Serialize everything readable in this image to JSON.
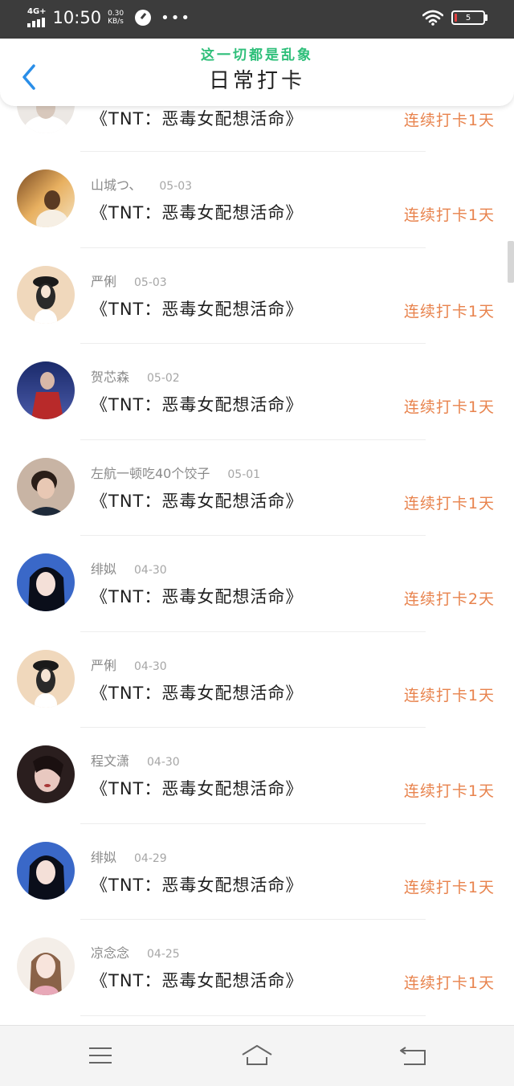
{
  "status_bar": {
    "network": "4G+",
    "time": "10:50",
    "speed_value": "0.30",
    "speed_unit": "KB/s",
    "battery": "5"
  },
  "header": {
    "overlay_text": "这一切都是乱象",
    "title": "日常打卡"
  },
  "first_item": {
    "book": "《TNT：恶毒女配想活命》",
    "streak": "连续打卡1天"
  },
  "items": [
    {
      "name": "山城つ、",
      "date": "05-03",
      "book": "《TNT：恶毒女配想活命》",
      "streak": "连续打卡1天"
    },
    {
      "name": "严俐",
      "date": "05-03",
      "book": "《TNT：恶毒女配想活命》",
      "streak": "连续打卡1天"
    },
    {
      "name": "贺芯森",
      "date": "05-02",
      "book": "《TNT：恶毒女配想活命》",
      "streak": "连续打卡1天"
    },
    {
      "name": "左航一顿吃40个饺子",
      "date": "05-01",
      "book": "《TNT：恶毒女配想活命》",
      "streak": "连续打卡1天"
    },
    {
      "name": "绯姒",
      "date": "04-30",
      "book": "《TNT：恶毒女配想活命》",
      "streak": "连续打卡2天"
    },
    {
      "name": "严俐",
      "date": "04-30",
      "book": "《TNT：恶毒女配想活命》",
      "streak": "连续打卡1天"
    },
    {
      "name": "程文潇",
      "date": "04-30",
      "book": "《TNT：恶毒女配想活命》",
      "streak": "连续打卡1天"
    },
    {
      "name": "绯姒",
      "date": "04-29",
      "book": "《TNT：恶毒女配想活命》",
      "streak": "连续打卡1天"
    },
    {
      "name": "凉念念",
      "date": "04-25",
      "book": "《TNT：恶毒女配想活命》",
      "streak": "连续打卡1天"
    }
  ],
  "colors": {
    "status_bar_bg": "#3c3c3c",
    "streak_text": "#e8834d",
    "back_icon": "#2a8ee8",
    "overlay_text": "#2fbf7a"
  }
}
